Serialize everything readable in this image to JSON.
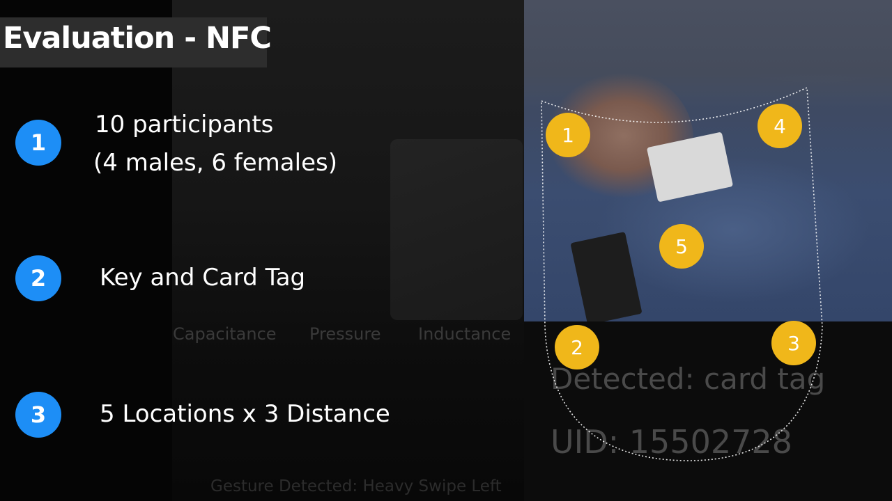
{
  "title": "Evaluation - NFC",
  "items": [
    {
      "number": "1",
      "line1": "10 participants",
      "line2": "(4 males, 6 females)"
    },
    {
      "number": "2",
      "line1": "Key and Card Tag"
    },
    {
      "number": "3",
      "line1": "5 Locations x 3 Distance"
    }
  ],
  "background_labels": {
    "capacitance": "Capacitance",
    "pressure": "Pressure",
    "inductance": "Inductance",
    "detected": "Detected: card tag",
    "uid": "UID: 15502728",
    "gesture": "Gesture Detected: Heavy Swipe Left"
  },
  "markers": [
    "1",
    "2",
    "3",
    "4",
    "5"
  ],
  "colors": {
    "bullet": "#1d8ef6",
    "marker": "#f0b71a",
    "title_bar": "#2d2d2d"
  }
}
